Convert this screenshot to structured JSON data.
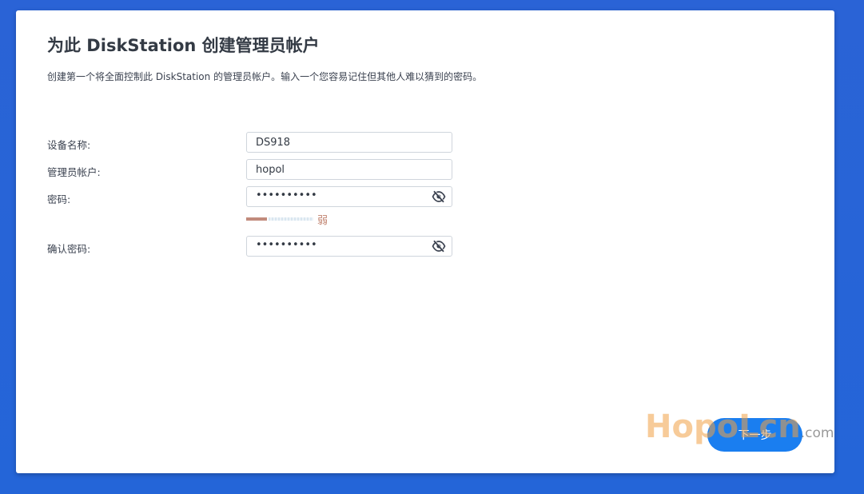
{
  "dialog": {
    "title": "为此 DiskStation 创建管理员帐户",
    "subtitle": "创建第一个将全面控制此 DiskStation 的管理员帐户。输入一个您容易记住但其他人难以猜到的密码。"
  },
  "form": {
    "device_name": {
      "label": "设备名称:",
      "value": "DS918"
    },
    "admin_account": {
      "label": "管理员帐户:",
      "value": "hopol"
    },
    "password": {
      "label": "密码:",
      "masked": "••••••••••",
      "icon": "eye-slash-icon"
    },
    "password_strength": {
      "label": "弱",
      "level": 0.25,
      "color": "#c18b7c"
    },
    "confirm_password": {
      "label": "确认密码:",
      "masked": "••••••••••",
      "icon": "eye-slash-icon"
    }
  },
  "footer": {
    "next_label": "下一步"
  },
  "watermark": {
    "brand": "HopoLcn",
    "suffix": ".com"
  },
  "colors": {
    "background": "#2465d8",
    "accent": "#1a7ef0",
    "text": "#333a44"
  }
}
